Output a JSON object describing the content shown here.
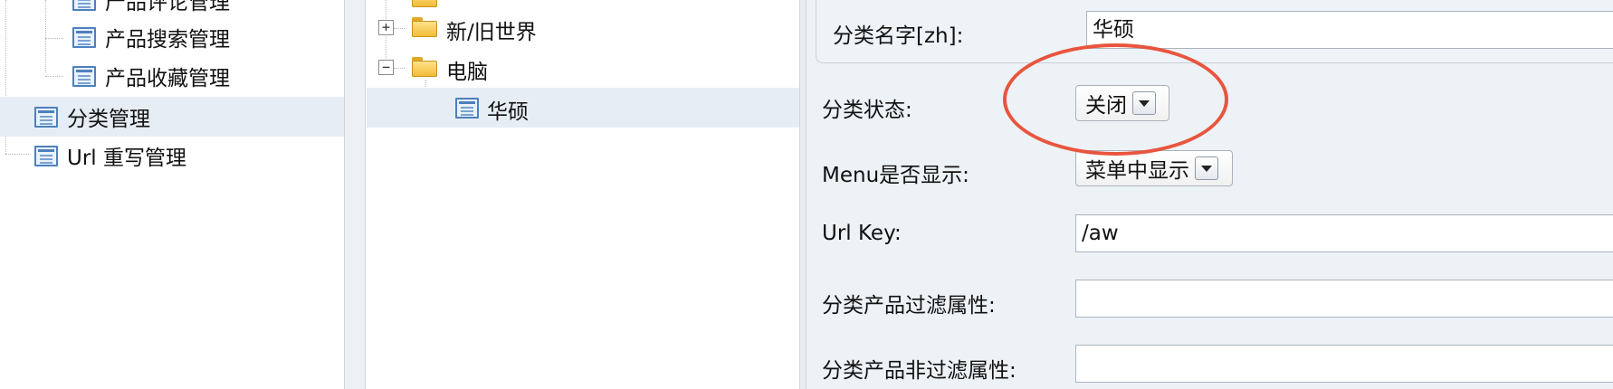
{
  "nav": {
    "items": [
      {
        "label": "产品评论管理"
      },
      {
        "label": "产品搜索管理"
      },
      {
        "label": "产品收藏管理"
      },
      {
        "label": "分类管理"
      },
      {
        "label": "Url 重写管理"
      }
    ]
  },
  "tree": {
    "nodes": [
      {
        "label": "新/旧世界",
        "toggle": "+"
      },
      {
        "label": "电脑",
        "toggle": "−"
      },
      {
        "label": "华硕"
      }
    ]
  },
  "form": {
    "name_label": "分类名字[zh]:",
    "name_value": "华硕",
    "status_label": "分类状态:",
    "status_value": "关闭",
    "menu_label": "Menu是否显示:",
    "menu_value": "菜单中显示",
    "urlkey_label": "Url Key:",
    "urlkey_value": "/aw",
    "filter_label": "分类产品过滤属性:",
    "filter_value": "",
    "nonfilter_label": "分类产品非过滤属性:",
    "nonfilter_value": ""
  },
  "colors": {
    "annotation": "#e8553e",
    "selected_row": "#e7edf4",
    "form_background": "#edf2f6"
  }
}
